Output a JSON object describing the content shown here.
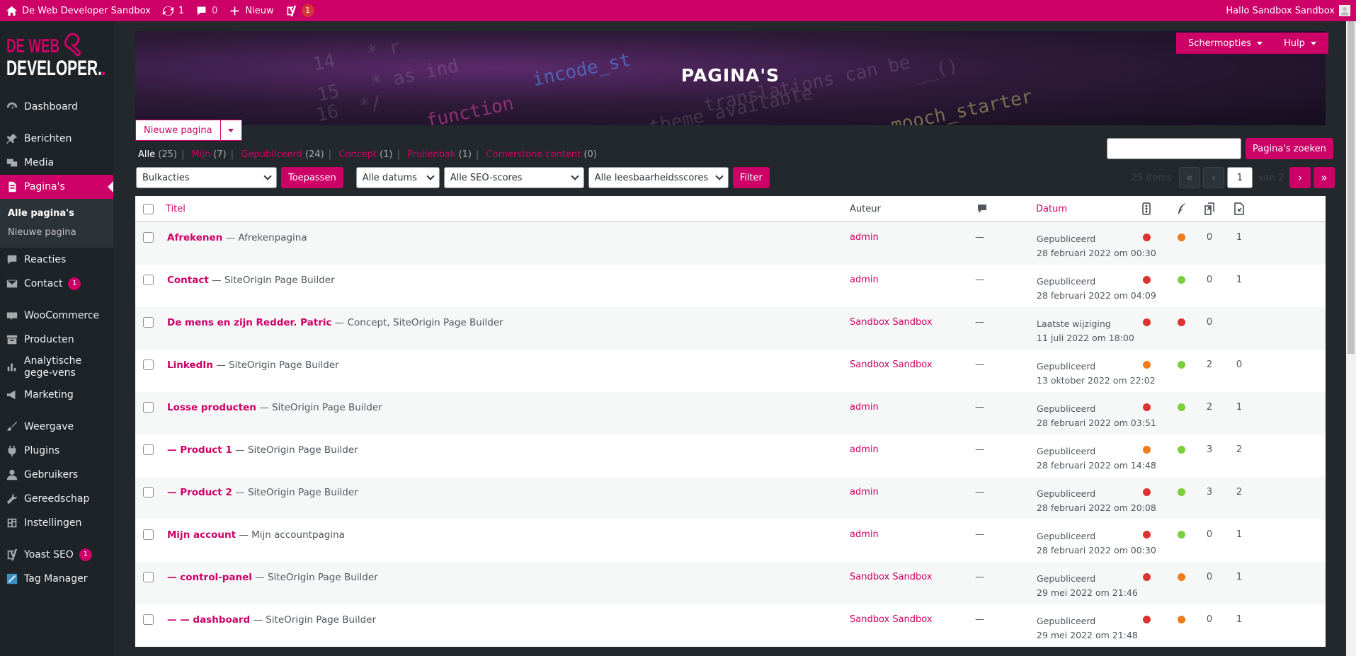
{
  "adminbar": {
    "site_name": "De Web Developer Sandbox",
    "updates_count": "1",
    "comments_count": "0",
    "new_label": "Nieuw",
    "yoast_badge": "1",
    "greeting": "Hallo Sandbox Sandbox"
  },
  "logo": {
    "line1": "DE WEB",
    "line2": "DEVELOPER."
  },
  "sidebar": {
    "items": [
      {
        "label": "Dashboard",
        "icon": "dashboard-icon"
      },
      {
        "label": "Berichten",
        "icon": "pin-icon"
      },
      {
        "label": "Media",
        "icon": "media-icon"
      },
      {
        "label": "Pagina's",
        "icon": "page-icon"
      },
      {
        "label": "Reacties",
        "icon": "comment-icon"
      },
      {
        "label": "Contact",
        "icon": "mail-icon",
        "badge": "1"
      },
      {
        "label": "WooCommerce",
        "icon": "woo-icon"
      },
      {
        "label": "Producten",
        "icon": "archive-icon"
      },
      {
        "label": "Analytische gege-vens",
        "icon": "chart-icon"
      },
      {
        "label": "Marketing",
        "icon": "megaphone-icon"
      },
      {
        "label": "Weergave",
        "icon": "brush-icon"
      },
      {
        "label": "Plugins",
        "icon": "plugin-icon"
      },
      {
        "label": "Gebruikers",
        "icon": "users-icon"
      },
      {
        "label": "Gereedschap",
        "icon": "wrench-icon"
      },
      {
        "label": "Instellingen",
        "icon": "settings-icon"
      },
      {
        "label": "Yoast SEO",
        "icon": "yoast-icon",
        "badge": "1"
      },
      {
        "label": "Tag Manager",
        "icon": "tag-manager-icon"
      }
    ],
    "submenu": [
      "Alle pagina's",
      "Nieuwe pagina"
    ]
  },
  "header": {
    "title": "PAGINA'S",
    "screen_options": "Schermopties",
    "help": "Hulp",
    "new_page": "Nieuwe pagina"
  },
  "filters": {
    "views": [
      {
        "label": "Alle",
        "count": "(25)"
      },
      {
        "label": "Mijn",
        "count": "(7)"
      },
      {
        "label": "Gepubliceerd",
        "count": "(24)"
      },
      {
        "label": "Concept",
        "count": "(1)"
      },
      {
        "label": "Prullenbak",
        "count": "(1)"
      },
      {
        "label": "Cornerstone content",
        "count": "(0)"
      }
    ],
    "bulk": "Bulkacties",
    "apply": "Toepassen",
    "dates": "Alle datums",
    "seo": "Alle SEO-scores",
    "readability": "Alle leesbaarheidsscores",
    "filter": "Filter",
    "search_button": "Pagina's zoeken",
    "items": "25 items",
    "page": "1",
    "of_pages": "van 2"
  },
  "table": {
    "headers": {
      "title": "Titel",
      "author": "Auteur",
      "date": "Datum"
    },
    "rows": [
      {
        "title": "Afrekenen",
        "state": " — Afrekenpagina",
        "author": "admin",
        "comments": "—",
        "status": "Gepubliceerd",
        "date": "28 februari 2022 om 00:30",
        "seo": "red",
        "read": "orange",
        "links_out": "0",
        "links_in": "1"
      },
      {
        "title": "Contact",
        "state": " — SiteOrigin Page Builder",
        "author": "admin",
        "comments": "—",
        "status": "Gepubliceerd",
        "date": "28 februari 2022 om 04:09",
        "seo": "red",
        "read": "green",
        "links_out": "0",
        "links_in": "1"
      },
      {
        "title": "De mens en zijn Redder. Patric",
        "state": " — Concept, SiteOrigin Page Builder",
        "author": "Sandbox Sandbox",
        "comments": "—",
        "status": "Laatste wijziging",
        "date": "11 juli 2022 om 18:00",
        "seo": "red",
        "read": "red",
        "links_out": "0",
        "links_in": ""
      },
      {
        "title": "LinkedIn",
        "state": " — SiteOrigin Page Builder",
        "author": "Sandbox Sandbox",
        "comments": "—",
        "status": "Gepubliceerd",
        "date": "13 oktober 2022 om 22:02",
        "seo": "orange",
        "read": "green",
        "links_out": "2",
        "links_in": "0"
      },
      {
        "title": "Losse producten",
        "state": " — SiteOrigin Page Builder",
        "author": "admin",
        "comments": "—",
        "status": "Gepubliceerd",
        "date": "28 februari 2022 om 03:51",
        "seo": "red",
        "read": "green",
        "links_out": "2",
        "links_in": "1"
      },
      {
        "title": "— Product 1",
        "state": " — SiteOrigin Page Builder",
        "author": "admin",
        "comments": "—",
        "status": "Gepubliceerd",
        "date": "28 februari 2022 om 14:48",
        "seo": "orange",
        "read": "green",
        "links_out": "3",
        "links_in": "2"
      },
      {
        "title": "— Product 2",
        "state": " — SiteOrigin Page Builder",
        "author": "admin",
        "comments": "—",
        "status": "Gepubliceerd",
        "date": "28 februari 2022 om 20:08",
        "seo": "red",
        "read": "green",
        "links_out": "3",
        "links_in": "2"
      },
      {
        "title": "Mijn account",
        "state": " — Mijn accountpagina",
        "author": "admin",
        "comments": "—",
        "status": "Gepubliceerd",
        "date": "28 februari 2022 om 00:30",
        "seo": "red",
        "read": "green",
        "links_out": "0",
        "links_in": "1"
      },
      {
        "title": "— control-panel",
        "state": " — SiteOrigin Page Builder",
        "author": "Sandbox Sandbox",
        "comments": "—",
        "status": "Gepubliceerd",
        "date": "29 mei 2022 om 21:46",
        "seo": "red",
        "read": "orange",
        "links_out": "0",
        "links_in": "1"
      },
      {
        "title": "— — dashboard",
        "state": " — SiteOrigin Page Builder",
        "author": "Sandbox Sandbox",
        "comments": "—",
        "status": "Gepubliceerd",
        "date": "29 mei 2022 om 21:48",
        "seo": "red",
        "read": "orange",
        "links_out": "0",
        "links_in": "1"
      }
    ]
  },
  "colors": {
    "accent": "#cc0066",
    "bg": "#23282d"
  }
}
